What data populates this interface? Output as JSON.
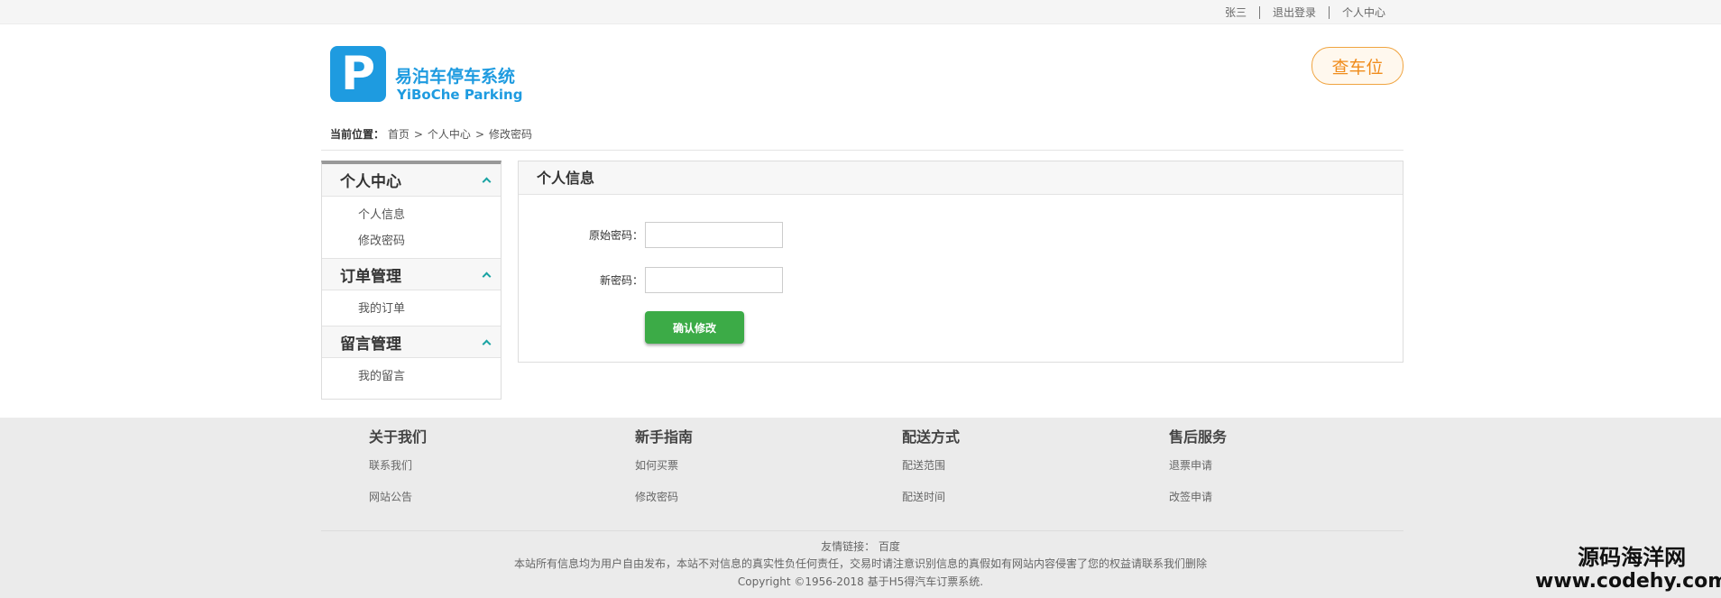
{
  "topbar": {
    "user": "张三",
    "logout": "退出登录",
    "center": "个人中心"
  },
  "header": {
    "logo_letter": "P",
    "brand_cn": "易泊车停车系统",
    "brand_en": "YiBoChe  Parking",
    "find_button": "查车位",
    "accent_color": "#1e9be0"
  },
  "breadcrumb": {
    "label": "当前位置：",
    "items": [
      "首页",
      "个人中心",
      "修改密码"
    ],
    "separator": ">"
  },
  "sidebar": {
    "groups": [
      {
        "title": "个人中心",
        "items": [
          "个人信息",
          "修改密码"
        ]
      },
      {
        "title": "订单管理",
        "items": [
          "我的订单"
        ]
      },
      {
        "title": "留言管理",
        "items": [
          "我的留言"
        ]
      }
    ]
  },
  "panel": {
    "title": "个人信息",
    "fields": [
      {
        "label": "原始密码：",
        "value": "",
        "placeholder": ""
      },
      {
        "label": "新密码：",
        "value": "",
        "placeholder": ""
      }
    ],
    "submit": "确认修改",
    "submit_color": "#3cab47"
  },
  "footer": {
    "columns": [
      {
        "title": "关于我们",
        "links": [
          "联系我们",
          "网站公告"
        ]
      },
      {
        "title": "新手指南",
        "links": [
          "如何买票",
          "修改密码"
        ]
      },
      {
        "title": "配送方式",
        "links": [
          "配送范围",
          "配送时间"
        ]
      },
      {
        "title": "售后服务",
        "links": [
          "退票申请",
          "改签申请"
        ]
      }
    ],
    "friend_label": "友情链接：",
    "friend_link": "百度",
    "disclaimer": "本站所有信息均为用户自由发布，本站不对信息的真实性负任何责任，交易时请注意识别信息的真假如有网站内容侵害了您的权益请联系我们删除",
    "copyright": "Copyright ©1956-2018 基于H5得汽车订票系统."
  },
  "watermark": {
    "line1": "源码海洋网",
    "line2": "www.codehy.com"
  }
}
